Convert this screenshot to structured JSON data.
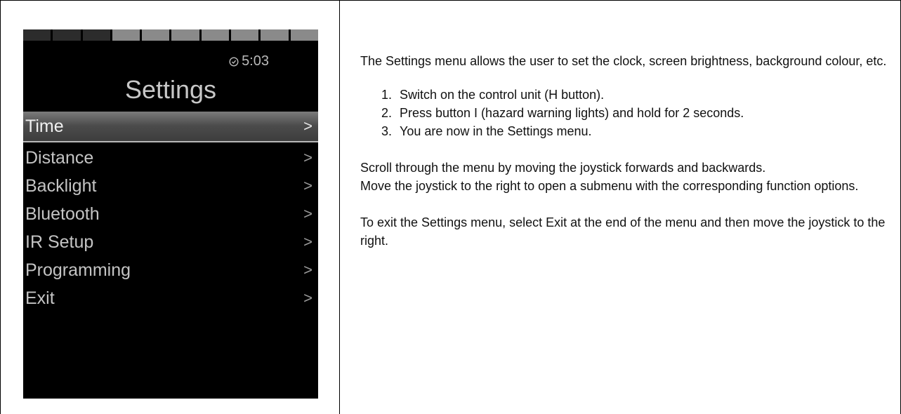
{
  "device": {
    "segments": [
      "#2c2c2c",
      "#2c2c2c",
      "#2c2c2c",
      "#8a8a8a",
      "#8a8a8a",
      "#8a8a8a",
      "#8a8a8a",
      "#8a8a8a",
      "#8a8a8a",
      "#8a8a8a"
    ],
    "clock_icon": "clock-icon",
    "time": "5:03",
    "title": "Settings",
    "menu": [
      {
        "label": "Time",
        "chevron": ">",
        "selected": true
      },
      {
        "label": "Distance",
        "chevron": ">",
        "selected": false
      },
      {
        "label": "Backlight",
        "chevron": ">",
        "selected": false
      },
      {
        "label": "Bluetooth",
        "chevron": ">",
        "selected": false
      },
      {
        "label": "IR Setup",
        "chevron": ">",
        "selected": false
      },
      {
        "label": "Programming",
        "chevron": ">",
        "selected": false
      },
      {
        "label": "Exit",
        "chevron": ">",
        "selected": false
      }
    ]
  },
  "text": {
    "intro": "The Settings menu allows the user to set the clock, screen brightness, background colour, etc.",
    "steps": [
      {
        "num": "1.",
        "text": "Switch on the control unit (H button)."
      },
      {
        "num": "2.",
        "text": "Press button I (hazard warning lights) and hold for 2 seconds."
      },
      {
        "num": "3.",
        "text": "You are now in the Settings menu."
      }
    ],
    "scroll": "Scroll through the menu by moving the joystick forwards and backwards.",
    "move": "Move the joystick to the right to open a submenu with the corresponding function options.",
    "exit": "To exit the Settings menu, select Exit at the end of the menu and then move the joystick to the right."
  }
}
